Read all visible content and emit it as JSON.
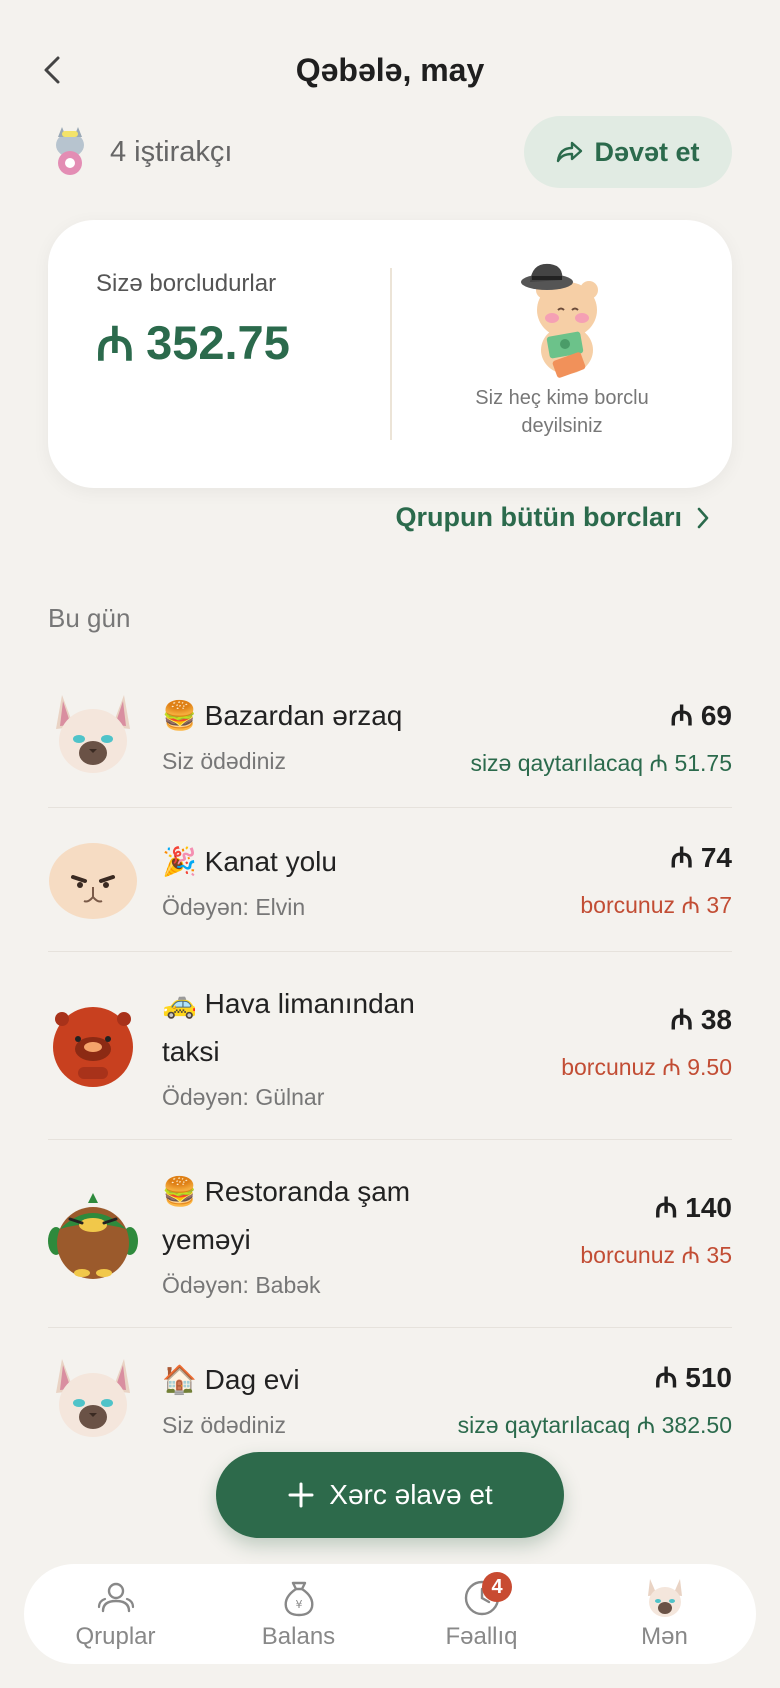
{
  "header": {
    "title": "Qəbələ, may"
  },
  "members": {
    "text": "4 iştirakçı"
  },
  "invite": {
    "label": "Dəvət et"
  },
  "summary": {
    "owed_label": "Sizə borcludurlar",
    "owed_amount": "352.75",
    "currency_symbol": "₼",
    "no_debt_text": "Siz heç kimə borclu deyilsiniz"
  },
  "all_debts_link": "Qrupun bütün borcları",
  "section_title": "Bu gün",
  "expenses": [
    {
      "emoji": "🍔",
      "name": "Bazardan ərzaq",
      "payer": "Siz ödədiniz",
      "amount": "₼ 69",
      "share": "sizə qaytarılacaq ₼ 51.75",
      "share_type": "credit",
      "avatar": "siamese-cat"
    },
    {
      "emoji": "🎉",
      "name": "Kanat yolu",
      "payer": "Ödəyən: Elvin",
      "amount": "₼ 74",
      "share": "borcunuz ₼ 37",
      "share_type": "debt",
      "avatar": "persian-cat"
    },
    {
      "emoji": "🚕",
      "name": "Hava limanından taksi",
      "payer": "Ödəyən: Gülnar",
      "amount": "₼ 38",
      "share": "borcunuz ₼ 9.50",
      "share_type": "debt",
      "avatar": "capybara"
    },
    {
      "emoji": "🍔",
      "name": "Restoranda şam yeməyi",
      "payer": "Ödəyən: Babək",
      "amount": "₼ 140",
      "share": "borcunuz ₼ 35",
      "share_type": "debt",
      "avatar": "duck"
    },
    {
      "emoji": "🏠",
      "name": "Dag evi",
      "payer": "Siz ödədiniz",
      "amount": "₼ 510",
      "share": "sizə qaytarılacaq ₼ 382.50",
      "share_type": "credit",
      "avatar": "siamese-cat"
    }
  ],
  "add_expense": {
    "label": "Xərc əlavə et"
  },
  "nav": {
    "items": [
      {
        "label": "Qruplar",
        "icon": "groups-icon"
      },
      {
        "label": "Balans",
        "icon": "money-bag-icon"
      },
      {
        "label": "Fəallıq",
        "icon": "clock-icon",
        "badge": "4"
      },
      {
        "label": "Mən",
        "icon": "profile-avatar-icon"
      }
    ]
  },
  "colors": {
    "accent": "#2b6a4c",
    "debt": "#c24d34",
    "background": "#f4f2ee"
  }
}
